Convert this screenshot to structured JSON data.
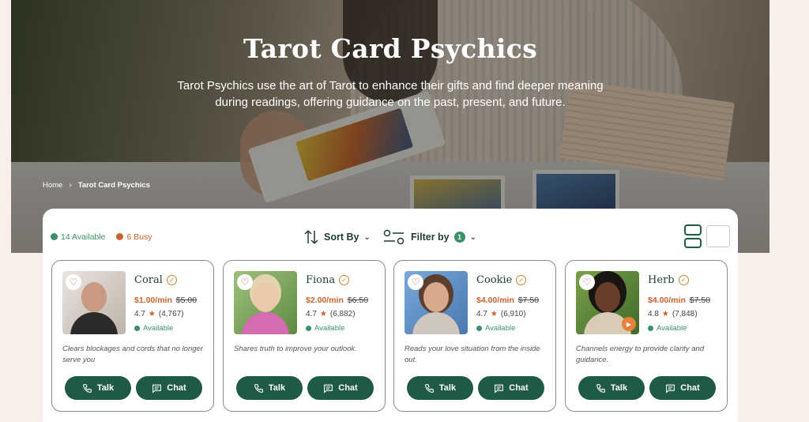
{
  "hero": {
    "title": "Tarot Card Psychics",
    "subtitle": "Tarot Psychics use the art of Tarot to enhance their gifts and find deeper meaning during readings, offering guidance on the past, present, and future.",
    "breadcrumb": {
      "home": "Home",
      "current": "Tarot Card Psychics"
    }
  },
  "status": {
    "available": "14 Available",
    "busy": "6 Busy",
    "available_color": "#3b8f6a",
    "busy_color": "#c8632b"
  },
  "toolbar": {
    "sort_label": "Sort By",
    "filter_label": "Filter by",
    "filter_count": "1"
  },
  "colors": {
    "accent": "#1f5a46",
    "price": "#c8632b"
  },
  "cards": [
    {
      "name": "Coral",
      "price": "$1.00/min",
      "old_price": "$5.00",
      "rating": "4.7",
      "reviews": "(4,767)",
      "status": "Available",
      "description": "Clears blockages and cords that no longer serve you",
      "talk": "Talk",
      "chat": "Chat"
    },
    {
      "name": "Fiona",
      "price": "$2.00/min",
      "old_price": "$6.50",
      "rating": "4.7",
      "reviews": "(6,882)",
      "status": "Available",
      "description": "Shares truth to improve your outlook.",
      "talk": "Talk",
      "chat": "Chat"
    },
    {
      "name": "Cookie",
      "price": "$4.00/min",
      "old_price": "$7.50",
      "rating": "4.7",
      "reviews": "(6,910)",
      "status": "Available",
      "description": "Reads your love situation from the inside out.",
      "talk": "Talk",
      "chat": "Chat"
    },
    {
      "name": "Herb",
      "price": "$4.00/min",
      "old_price": "$7.50",
      "rating": "4.8",
      "reviews": "(7,848)",
      "status": "Available",
      "description": "Channels energy to provide clarity and guidance.",
      "talk": "Talk",
      "chat": "Chat"
    }
  ]
}
